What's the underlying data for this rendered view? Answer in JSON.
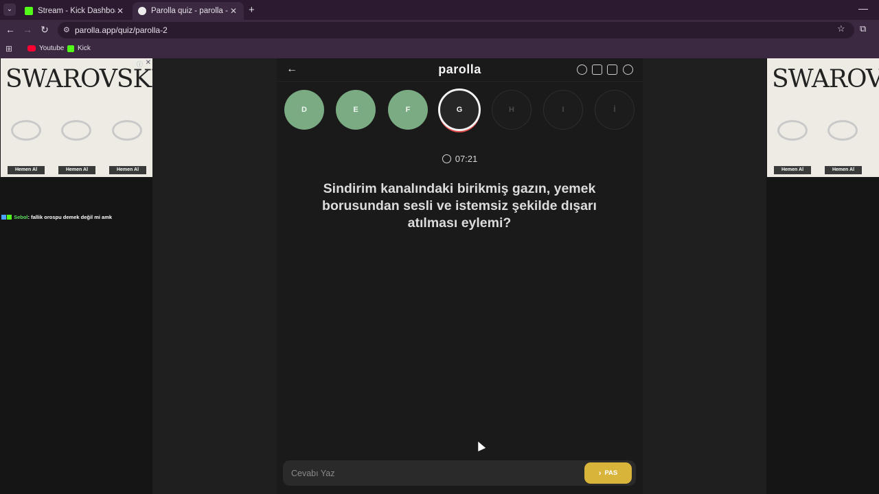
{
  "browser": {
    "tabs": [
      {
        "title": "Stream - Kick Dashboard",
        "favicon": "kick-icon"
      },
      {
        "title": "Parolla quiz - parolla - Kelime o",
        "favicon": "parolla-icon"
      }
    ],
    "url": "parolla.app/quiz/parolla-2",
    "bookmarks": [
      {
        "label": "Youtube",
        "icon": "youtube-icon"
      },
      {
        "label": "Kick",
        "icon": "kick-icon"
      }
    ]
  },
  "ads": {
    "brand": "SWAROVSKI",
    "button_label": "Hemen Al"
  },
  "chat": {
    "user": "Sebol",
    "message": ": fallik orospu demek değil mi amk"
  },
  "app": {
    "logo": "parolla",
    "letters": [
      {
        "char": "D",
        "state": "done"
      },
      {
        "char": "E",
        "state": "done"
      },
      {
        "char": "F",
        "state": "done"
      },
      {
        "char": "G",
        "state": "current"
      },
      {
        "char": "H",
        "state": "todo"
      },
      {
        "char": "I",
        "state": "todo"
      },
      {
        "char": "İ",
        "state": "todo"
      }
    ],
    "timer": "07:21",
    "question": "Sindirim kanalındaki birikmiş gazın, yemek borusundan sesli ve istemsiz şekilde dışarı atılması eylemi?",
    "answer_placeholder": "Cevabı Yaz",
    "pass_label": "PAS",
    "colors": {
      "done": "#7aab82",
      "pass_button": "#d9b43a",
      "current_ring": "#e04a4a"
    }
  }
}
